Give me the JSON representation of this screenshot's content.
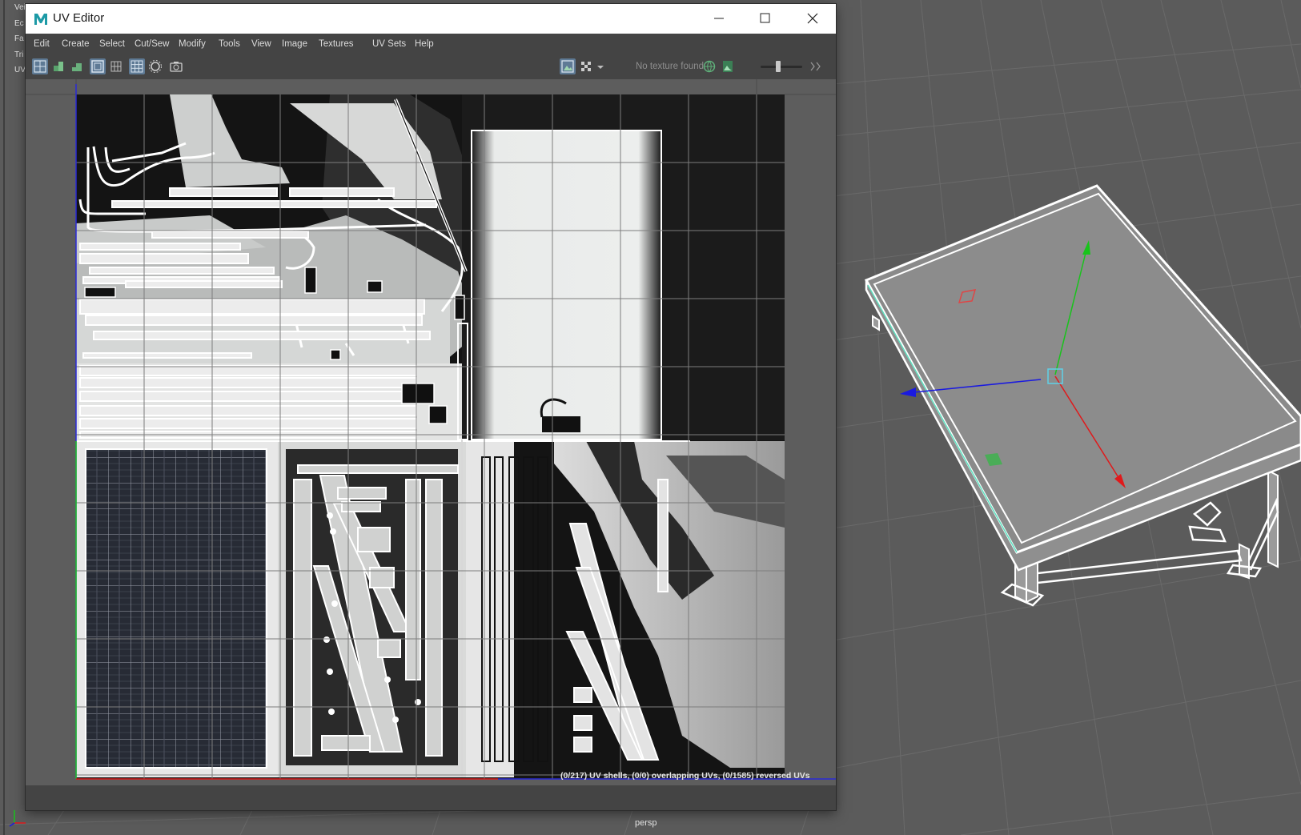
{
  "hud": {
    "rows": [
      "Vei",
      "Ec",
      "Fa",
      "Tri",
      "UV"
    ]
  },
  "viewport": {
    "camera_label": "persp"
  },
  "window": {
    "title": "UV Editor",
    "app_icon": "maya-logo-icon",
    "controls": [
      "minimize-icon",
      "maximize-icon",
      "close-icon"
    ]
  },
  "menu": {
    "items": [
      "Edit",
      "Create",
      "Select",
      "Cut/Sew",
      "Modify",
      "Tools",
      "View",
      "Image",
      "Textures",
      "UV Sets",
      "Help"
    ]
  },
  "toolbar": {
    "texture_status": "No texture found"
  },
  "status": {
    "message": "(0/217) UV shells, (0/0) overlapping UVs, (0/1585) reversed UVs"
  },
  "colors": {
    "accent": "#5e7a95",
    "axis_x": "#e0191b",
    "axis_y": "#18c41b",
    "axis_z": "#1a1ae0",
    "window_bg": "#444444",
    "viewport_bg": "#5b5b5b"
  }
}
